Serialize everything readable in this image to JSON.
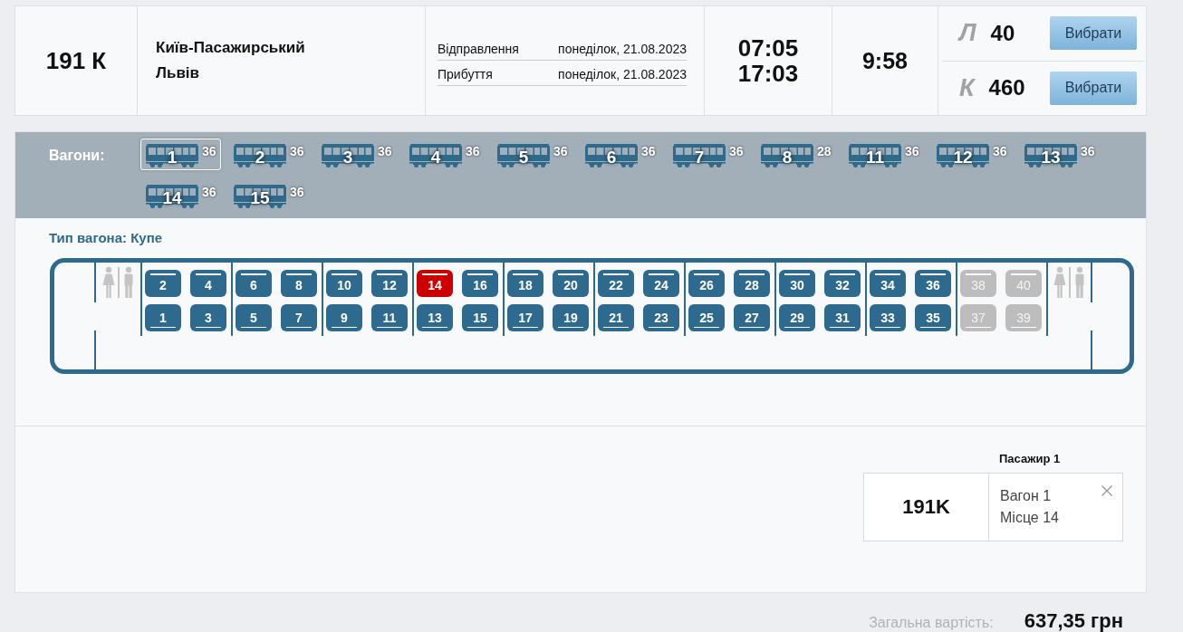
{
  "train": {
    "number": "191 К",
    "route": {
      "from": "Київ-Пасажирський",
      "to": "Львів"
    },
    "schedule": [
      {
        "label": "Відправлення",
        "date": "понеділок, 21.08.2023"
      },
      {
        "label": "Прибуття",
        "date": "понеділок, 21.08.2023"
      }
    ],
    "times": [
      "07:05",
      "17:03"
    ],
    "duration": "9:58",
    "classes": [
      {
        "code": "Л",
        "seats": "40",
        "button": "Вибрати"
      },
      {
        "code": "К",
        "seats": "460",
        "button": "Вибрати"
      }
    ]
  },
  "wagons_panel": {
    "label": "Вагони:",
    "wagons": [
      {
        "number": "1",
        "seats": "36",
        "selected": true
      },
      {
        "number": "2",
        "seats": "36",
        "selected": false
      },
      {
        "number": "3",
        "seats": "36",
        "selected": false
      },
      {
        "number": "4",
        "seats": "36",
        "selected": false
      },
      {
        "number": "5",
        "seats": "36",
        "selected": false
      },
      {
        "number": "6",
        "seats": "36",
        "selected": false
      },
      {
        "number": "7",
        "seats": "36",
        "selected": false
      },
      {
        "number": "8",
        "seats": "28",
        "selected": false
      },
      {
        "number": "11",
        "seats": "36",
        "selected": false
      },
      {
        "number": "12",
        "seats": "36",
        "selected": false
      },
      {
        "number": "13",
        "seats": "36",
        "selected": false
      },
      {
        "number": "14",
        "seats": "36",
        "selected": false
      },
      {
        "number": "15",
        "seats": "36",
        "selected": false
      }
    ]
  },
  "coach": {
    "type_label": "Тип вагона: Купе",
    "compartments": [
      {
        "upper": [
          {
            "number": "2",
            "available": true,
            "selected": false
          },
          {
            "number": "4",
            "available": true,
            "selected": false
          }
        ],
        "lower": [
          {
            "number": "1",
            "available": true,
            "selected": false
          },
          {
            "number": "3",
            "available": true,
            "selected": false
          }
        ]
      },
      {
        "upper": [
          {
            "number": "6",
            "available": true,
            "selected": false
          },
          {
            "number": "8",
            "available": true,
            "selected": false
          }
        ],
        "lower": [
          {
            "number": "5",
            "available": true,
            "selected": false
          },
          {
            "number": "7",
            "available": true,
            "selected": false
          }
        ]
      },
      {
        "upper": [
          {
            "number": "10",
            "available": true,
            "selected": false
          },
          {
            "number": "12",
            "available": true,
            "selected": false
          }
        ],
        "lower": [
          {
            "number": "9",
            "available": true,
            "selected": false
          },
          {
            "number": "11",
            "available": true,
            "selected": false
          }
        ]
      },
      {
        "upper": [
          {
            "number": "14",
            "available": true,
            "selected": true
          },
          {
            "number": "16",
            "available": true,
            "selected": false
          }
        ],
        "lower": [
          {
            "number": "13",
            "available": true,
            "selected": false
          },
          {
            "number": "15",
            "available": true,
            "selected": false
          }
        ]
      },
      {
        "upper": [
          {
            "number": "18",
            "available": true,
            "selected": false
          },
          {
            "number": "20",
            "available": true,
            "selected": false
          }
        ],
        "lower": [
          {
            "number": "17",
            "available": true,
            "selected": false
          },
          {
            "number": "19",
            "available": true,
            "selected": false
          }
        ]
      },
      {
        "upper": [
          {
            "number": "22",
            "available": true,
            "selected": false
          },
          {
            "number": "24",
            "available": true,
            "selected": false
          }
        ],
        "lower": [
          {
            "number": "21",
            "available": true,
            "selected": false
          },
          {
            "number": "23",
            "available": true,
            "selected": false
          }
        ]
      },
      {
        "upper": [
          {
            "number": "26",
            "available": true,
            "selected": false
          },
          {
            "number": "28",
            "available": true,
            "selected": false
          }
        ],
        "lower": [
          {
            "number": "25",
            "available": true,
            "selected": false
          },
          {
            "number": "27",
            "available": true,
            "selected": false
          }
        ]
      },
      {
        "upper": [
          {
            "number": "30",
            "available": true,
            "selected": false
          },
          {
            "number": "32",
            "available": true,
            "selected": false
          }
        ],
        "lower": [
          {
            "number": "29",
            "available": true,
            "selected": false
          },
          {
            "number": "31",
            "available": true,
            "selected": false
          }
        ]
      },
      {
        "upper": [
          {
            "number": "34",
            "available": true,
            "selected": false
          },
          {
            "number": "36",
            "available": true,
            "selected": false
          }
        ],
        "lower": [
          {
            "number": "33",
            "available": true,
            "selected": false
          },
          {
            "number": "35",
            "available": true,
            "selected": false
          }
        ]
      },
      {
        "upper": [
          {
            "number": "38",
            "available": false,
            "selected": false
          },
          {
            "number": "40",
            "available": false,
            "selected": false
          }
        ],
        "lower": [
          {
            "number": "37",
            "available": false,
            "selected": false
          },
          {
            "number": "39",
            "available": false,
            "selected": false
          }
        ]
      }
    ]
  },
  "passenger": {
    "label": "Пасажир 1",
    "train": "191K",
    "wagon": "Вагон 1",
    "seat": "Місце 14"
  },
  "total": {
    "label": "Загальна вартість:",
    "amount": "637,35 грн"
  }
}
